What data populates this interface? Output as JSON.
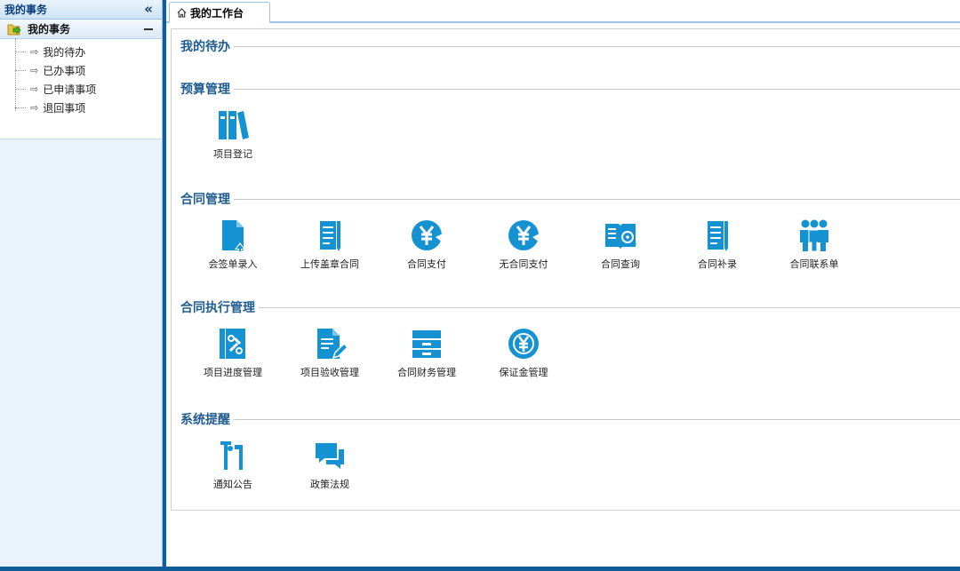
{
  "sidebar": {
    "title": "我的事务",
    "collapse_glyph": "«",
    "group": {
      "label": "我的事务",
      "icon": "folder-arrow-icon"
    },
    "items": [
      {
        "label": "我的待办",
        "icon": "arrow-right-icon"
      },
      {
        "label": "已办事项",
        "icon": "arrow-right-icon"
      },
      {
        "label": "已申请事项",
        "icon": "arrow-right-icon"
      },
      {
        "label": "退回事项",
        "icon": "arrow-right-icon"
      }
    ]
  },
  "tabs": [
    {
      "label": "我的工作台",
      "icon": "home-icon"
    }
  ],
  "sections": [
    {
      "title": "我的待办",
      "items": []
    },
    {
      "title": "预算管理",
      "items": [
        {
          "label": "项目登记",
          "icon": "binders-icon"
        }
      ]
    },
    {
      "title": "合同管理",
      "items": [
        {
          "label": "会签单录入",
          "icon": "document-upload-icon"
        },
        {
          "label": "上传盖章合同",
          "icon": "notebook-icon"
        },
        {
          "label": "合同支付",
          "icon": "yen-coin-icon"
        },
        {
          "label": "无合同支付",
          "icon": "yen-coin-icon"
        },
        {
          "label": "合同查询",
          "icon": "book-search-icon"
        },
        {
          "label": "合同补录",
          "icon": "notebook-icon"
        },
        {
          "label": "合同联系单",
          "icon": "people-group-icon"
        }
      ]
    },
    {
      "title": "合同执行管理",
      "items": [
        {
          "label": "项目进度管理",
          "icon": "tools-book-icon"
        },
        {
          "label": "项目验收管理",
          "icon": "document-edit-icon"
        },
        {
          "label": "合同财务管理",
          "icon": "archive-drawer-icon"
        },
        {
          "label": "保证金管理",
          "icon": "yen-shield-icon"
        }
      ]
    },
    {
      "title": "系统提醒",
      "items": [
        {
          "label": "通知公告",
          "icon": "bulletin-icon"
        },
        {
          "label": "政策法规",
          "icon": "chat-bubbles-icon"
        }
      ]
    }
  ],
  "colors": {
    "accent": "#1592d1",
    "section_title": "#1f5c8f",
    "bar": "#0e5c9a"
  }
}
